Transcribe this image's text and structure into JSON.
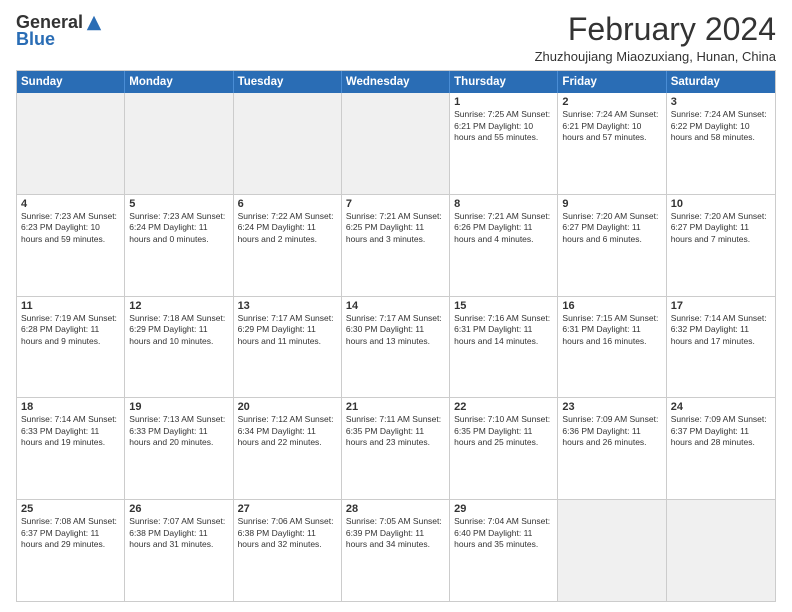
{
  "logo": {
    "general": "General",
    "blue": "Blue"
  },
  "title": "February 2024",
  "subtitle": "Zhuzhoujiang Miaozuxiang, Hunan, China",
  "header_days": [
    "Sunday",
    "Monday",
    "Tuesday",
    "Wednesday",
    "Thursday",
    "Friday",
    "Saturday"
  ],
  "weeks": [
    [
      {
        "day": "",
        "info": "",
        "shaded": true
      },
      {
        "day": "",
        "info": "",
        "shaded": true
      },
      {
        "day": "",
        "info": "",
        "shaded": true
      },
      {
        "day": "",
        "info": "",
        "shaded": true
      },
      {
        "day": "1",
        "info": "Sunrise: 7:25 AM\nSunset: 6:21 PM\nDaylight: 10 hours\nand 55 minutes."
      },
      {
        "day": "2",
        "info": "Sunrise: 7:24 AM\nSunset: 6:21 PM\nDaylight: 10 hours\nand 57 minutes."
      },
      {
        "day": "3",
        "info": "Sunrise: 7:24 AM\nSunset: 6:22 PM\nDaylight: 10 hours\nand 58 minutes."
      }
    ],
    [
      {
        "day": "4",
        "info": "Sunrise: 7:23 AM\nSunset: 6:23 PM\nDaylight: 10 hours\nand 59 minutes."
      },
      {
        "day": "5",
        "info": "Sunrise: 7:23 AM\nSunset: 6:24 PM\nDaylight: 11 hours\nand 0 minutes."
      },
      {
        "day": "6",
        "info": "Sunrise: 7:22 AM\nSunset: 6:24 PM\nDaylight: 11 hours\nand 2 minutes."
      },
      {
        "day": "7",
        "info": "Sunrise: 7:21 AM\nSunset: 6:25 PM\nDaylight: 11 hours\nand 3 minutes."
      },
      {
        "day": "8",
        "info": "Sunrise: 7:21 AM\nSunset: 6:26 PM\nDaylight: 11 hours\nand 4 minutes."
      },
      {
        "day": "9",
        "info": "Sunrise: 7:20 AM\nSunset: 6:27 PM\nDaylight: 11 hours\nand 6 minutes."
      },
      {
        "day": "10",
        "info": "Sunrise: 7:20 AM\nSunset: 6:27 PM\nDaylight: 11 hours\nand 7 minutes."
      }
    ],
    [
      {
        "day": "11",
        "info": "Sunrise: 7:19 AM\nSunset: 6:28 PM\nDaylight: 11 hours\nand 9 minutes."
      },
      {
        "day": "12",
        "info": "Sunrise: 7:18 AM\nSunset: 6:29 PM\nDaylight: 11 hours\nand 10 minutes."
      },
      {
        "day": "13",
        "info": "Sunrise: 7:17 AM\nSunset: 6:29 PM\nDaylight: 11 hours\nand 11 minutes."
      },
      {
        "day": "14",
        "info": "Sunrise: 7:17 AM\nSunset: 6:30 PM\nDaylight: 11 hours\nand 13 minutes."
      },
      {
        "day": "15",
        "info": "Sunrise: 7:16 AM\nSunset: 6:31 PM\nDaylight: 11 hours\nand 14 minutes."
      },
      {
        "day": "16",
        "info": "Sunrise: 7:15 AM\nSunset: 6:31 PM\nDaylight: 11 hours\nand 16 minutes."
      },
      {
        "day": "17",
        "info": "Sunrise: 7:14 AM\nSunset: 6:32 PM\nDaylight: 11 hours\nand 17 minutes."
      }
    ],
    [
      {
        "day": "18",
        "info": "Sunrise: 7:14 AM\nSunset: 6:33 PM\nDaylight: 11 hours\nand 19 minutes."
      },
      {
        "day": "19",
        "info": "Sunrise: 7:13 AM\nSunset: 6:33 PM\nDaylight: 11 hours\nand 20 minutes."
      },
      {
        "day": "20",
        "info": "Sunrise: 7:12 AM\nSunset: 6:34 PM\nDaylight: 11 hours\nand 22 minutes."
      },
      {
        "day": "21",
        "info": "Sunrise: 7:11 AM\nSunset: 6:35 PM\nDaylight: 11 hours\nand 23 minutes."
      },
      {
        "day": "22",
        "info": "Sunrise: 7:10 AM\nSunset: 6:35 PM\nDaylight: 11 hours\nand 25 minutes."
      },
      {
        "day": "23",
        "info": "Sunrise: 7:09 AM\nSunset: 6:36 PM\nDaylight: 11 hours\nand 26 minutes."
      },
      {
        "day": "24",
        "info": "Sunrise: 7:09 AM\nSunset: 6:37 PM\nDaylight: 11 hours\nand 28 minutes."
      }
    ],
    [
      {
        "day": "25",
        "info": "Sunrise: 7:08 AM\nSunset: 6:37 PM\nDaylight: 11 hours\nand 29 minutes."
      },
      {
        "day": "26",
        "info": "Sunrise: 7:07 AM\nSunset: 6:38 PM\nDaylight: 11 hours\nand 31 minutes."
      },
      {
        "day": "27",
        "info": "Sunrise: 7:06 AM\nSunset: 6:38 PM\nDaylight: 11 hours\nand 32 minutes."
      },
      {
        "day": "28",
        "info": "Sunrise: 7:05 AM\nSunset: 6:39 PM\nDaylight: 11 hours\nand 34 minutes."
      },
      {
        "day": "29",
        "info": "Sunrise: 7:04 AM\nSunset: 6:40 PM\nDaylight: 11 hours\nand 35 minutes."
      },
      {
        "day": "",
        "info": "",
        "shaded": true
      },
      {
        "day": "",
        "info": "",
        "shaded": true
      }
    ]
  ],
  "accent_color": "#2a6db5"
}
